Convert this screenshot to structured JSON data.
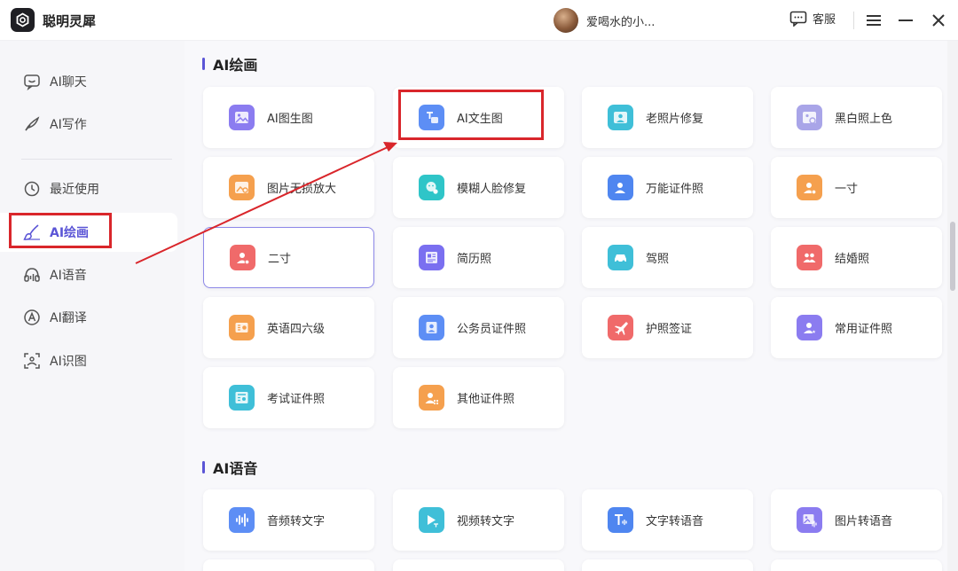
{
  "app": {
    "title": "聪明灵犀",
    "logo_icon": "app-logo-icon"
  },
  "header": {
    "username": "爱喝水的小...",
    "service_label": "客服",
    "icons": [
      "chat-bubble-icon",
      "hamburger-menu-icon",
      "minimize-icon",
      "close-icon"
    ]
  },
  "sidebar": {
    "items": [
      {
        "label": "AI聊天",
        "icon": "chat-icon"
      },
      {
        "label": "AI写作",
        "icon": "quill-icon"
      },
      {
        "label": "最近使用",
        "icon": "history-icon"
      },
      {
        "label": "AI绘画",
        "icon": "brush-icon",
        "active": true
      },
      {
        "label": "AI语音",
        "icon": "voice-icon"
      },
      {
        "label": "AI翻译",
        "icon": "translate-icon"
      },
      {
        "label": "AI识图",
        "icon": "scan-image-icon"
      }
    ]
  },
  "sections": [
    {
      "title": "AI绘画",
      "cards": [
        {
          "label": "AI图生图",
          "color": "#8b7cf0"
        },
        {
          "label": "AI文生图",
          "color": "#5d8ef5"
        },
        {
          "label": "老照片修复",
          "color": "#3fbfd8"
        },
        {
          "label": "黑白照上色",
          "color": "#a9a5e8"
        },
        {
          "label": "图片无损放大",
          "color": "#f5a04e"
        },
        {
          "label": "模糊人脸修复",
          "color": "#2fc5c8"
        },
        {
          "label": "万能证件照",
          "color": "#4f86f0"
        },
        {
          "label": "一寸",
          "color": "#f5a04e"
        },
        {
          "label": "二寸",
          "color": "#f06a6a"
        },
        {
          "label": "简历照",
          "color": "#7a6ff0"
        },
        {
          "label": "驾照",
          "color": "#3fbfd8"
        },
        {
          "label": "结婚照",
          "color": "#f06a6a"
        },
        {
          "label": "英语四六级",
          "color": "#f5a04e"
        },
        {
          "label": "公务员证件照",
          "color": "#5d8ef5"
        },
        {
          "label": "护照签证",
          "color": "#f06a6a"
        },
        {
          "label": "常用证件照",
          "color": "#8b7cf0"
        },
        {
          "label": "考试证件照",
          "color": "#3fbfd8"
        },
        {
          "label": "其他证件照",
          "color": "#f5a04e"
        }
      ]
    },
    {
      "title": "AI语音",
      "cards": [
        {
          "label": "音频转文字",
          "color": "#5d8ef5"
        },
        {
          "label": "视频转文字",
          "color": "#3fbfd8"
        },
        {
          "label": "文字转语音",
          "color": "#4f86f0"
        },
        {
          "label": "图片转语音",
          "color": "#8b7cf0"
        }
      ]
    }
  ],
  "colors": {
    "accent": "#5b55d6",
    "highlight_red": "#d9262b"
  }
}
